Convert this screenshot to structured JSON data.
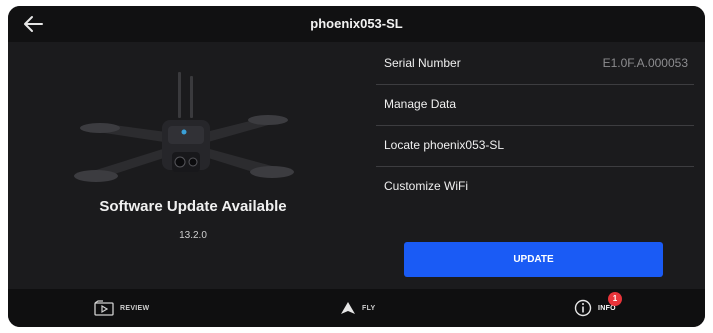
{
  "header": {
    "title": "phoenix053-SL",
    "back_icon": "arrow-left-icon"
  },
  "device": {
    "status": "Software Update Available",
    "version": "13.2.0"
  },
  "list": {
    "serial_label": "Serial Number",
    "serial_value": "E1.0F.A.000053",
    "manage_data": "Manage Data",
    "locate": "Locate phoenix053-SL",
    "customize_wifi": "Customize WiFi"
  },
  "update_button": "UPDATE",
  "nav": {
    "review": "REVIEW",
    "fly": "FLY",
    "info": "INFO",
    "info_badge": "1"
  },
  "colors": {
    "background": "#1b1b1d",
    "accent": "#1a5bf5",
    "badge": "#e8343a"
  }
}
